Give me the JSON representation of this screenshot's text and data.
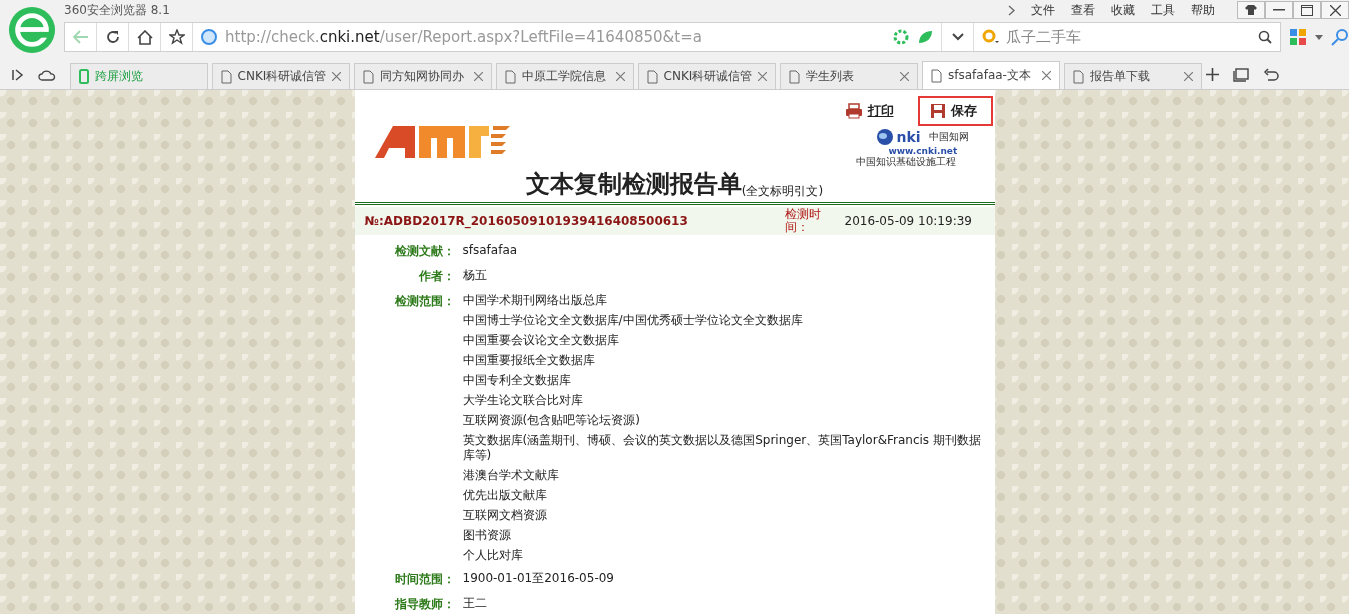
{
  "window": {
    "title": "360安全浏览器 8.1",
    "menu": [
      "文件",
      "查看",
      "收藏",
      "工具",
      "帮助"
    ]
  },
  "address": {
    "prefix": "http://check.",
    "domain": "cnki.net",
    "path": "/user/Report.aspx?LeftFile=41640850&t=a"
  },
  "search": {
    "placeholder": "瓜子二手车"
  },
  "tabs": [
    {
      "kind": "special",
      "label": "跨屏浏览",
      "selected": false
    },
    {
      "kind": "page",
      "label": "CNKI科研诚信管",
      "selected": false
    },
    {
      "kind": "page",
      "label": "同方知网协同办",
      "selected": false
    },
    {
      "kind": "page",
      "label": "中原工学院信息",
      "selected": false
    },
    {
      "kind": "page",
      "label": "CNKI科研诚信管",
      "selected": false
    },
    {
      "kind": "page",
      "label": "学生列表",
      "selected": false
    },
    {
      "kind": "page",
      "label": "sfsafafaa-文本",
      "selected": true
    },
    {
      "kind": "page",
      "label": "报告单下载",
      "selected": false
    }
  ],
  "report": {
    "actions": [
      {
        "kind": "print",
        "label": "打印",
        "highlighted": false
      },
      {
        "kind": "save",
        "label": "保存",
        "highlighted": true
      }
    ],
    "cnki_logo": {
      "name": "nki",
      "cn_name": "中国知网",
      "url": "www.cnki.net",
      "tagline": "中国知识基础设施工程"
    },
    "title": "文本复制检测报告单",
    "subtitle": "(全文标明引文)",
    "number": "№:ADBD2017R_20160509101939416408500613",
    "time_label": "检测时间：",
    "time": "2016-05-09 10:19:39",
    "fields": [
      {
        "label": "检测文献：",
        "values": [
          "sfsafafaa"
        ]
      },
      {
        "label": "作者：",
        "values": [
          "杨五"
        ]
      },
      {
        "label": "检测范围：",
        "values": [
          "中国学术期刊网络出版总库",
          "中国博士学位论文全文数据库/中国优秀硕士学位论文全文数据库",
          "中国重要会议论文全文数据库",
          "中国重要报纸全文数据库",
          "中国专利全文数据库",
          "大学生论文联合比对库",
          "互联网资源(包含贴吧等论坛资源)",
          "英文数据库(涵盖期刊、博硕、会议的英文数据以及德国Springer、英国Taylor&Francis 期刊数据库等)",
          "港澳台学术文献库",
          "优先出版文献库",
          "互联网文档资源",
          "图书资源",
          "个人比对库"
        ]
      },
      {
        "label": "时间范围：",
        "values": [
          "1900-01-01至2016-05-09"
        ]
      },
      {
        "label": "指导教师：",
        "values": [
          "王二"
        ]
      }
    ]
  }
}
